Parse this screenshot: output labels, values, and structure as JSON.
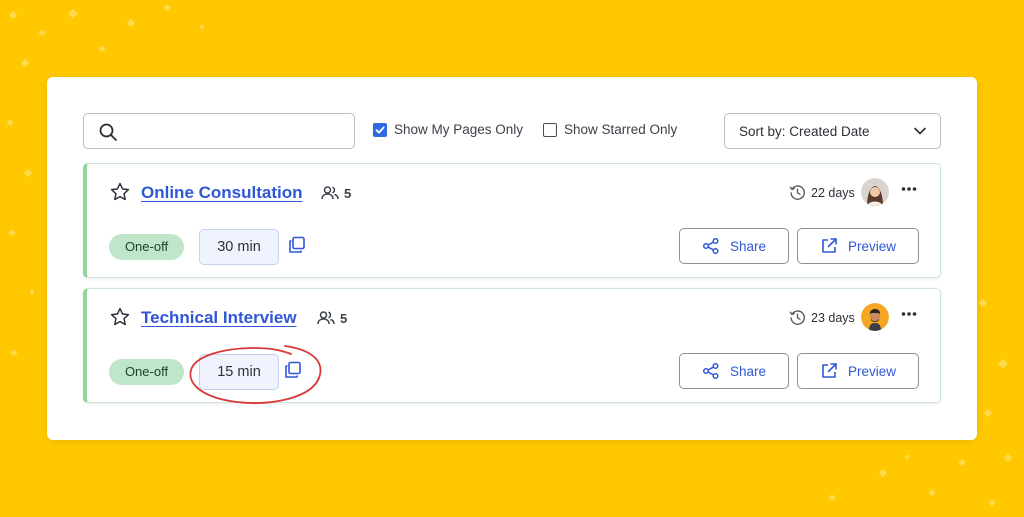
{
  "colors": {
    "background": "#FFC800",
    "accent": "#2F57D6",
    "checkbox": "#2F6AE0",
    "card_border": "#8FD69E",
    "badge": "#BFE6C8",
    "annotation": "#D9383A"
  },
  "toolbar": {
    "search": {
      "placeholder": "",
      "value": "",
      "icon": "search-icon"
    },
    "filters": [
      {
        "label": "Show My Pages Only",
        "checked": true
      },
      {
        "label": "Show Starred Only",
        "checked": false
      }
    ],
    "sort": {
      "label": "Sort by: Created Date",
      "icon": "chevron-down-icon"
    }
  },
  "cards": [
    {
      "title": "Online Consultation",
      "members": "5",
      "age": "22 days",
      "type": "One-off",
      "duration": "30 min",
      "starred": false,
      "share_label": "Share",
      "preview_label": "Preview"
    },
    {
      "title": "Technical Interview",
      "members": "5",
      "age": "23 days",
      "type": "One-off",
      "duration": "15 min",
      "starred": false,
      "share_label": "Share",
      "preview_label": "Preview"
    }
  ]
}
